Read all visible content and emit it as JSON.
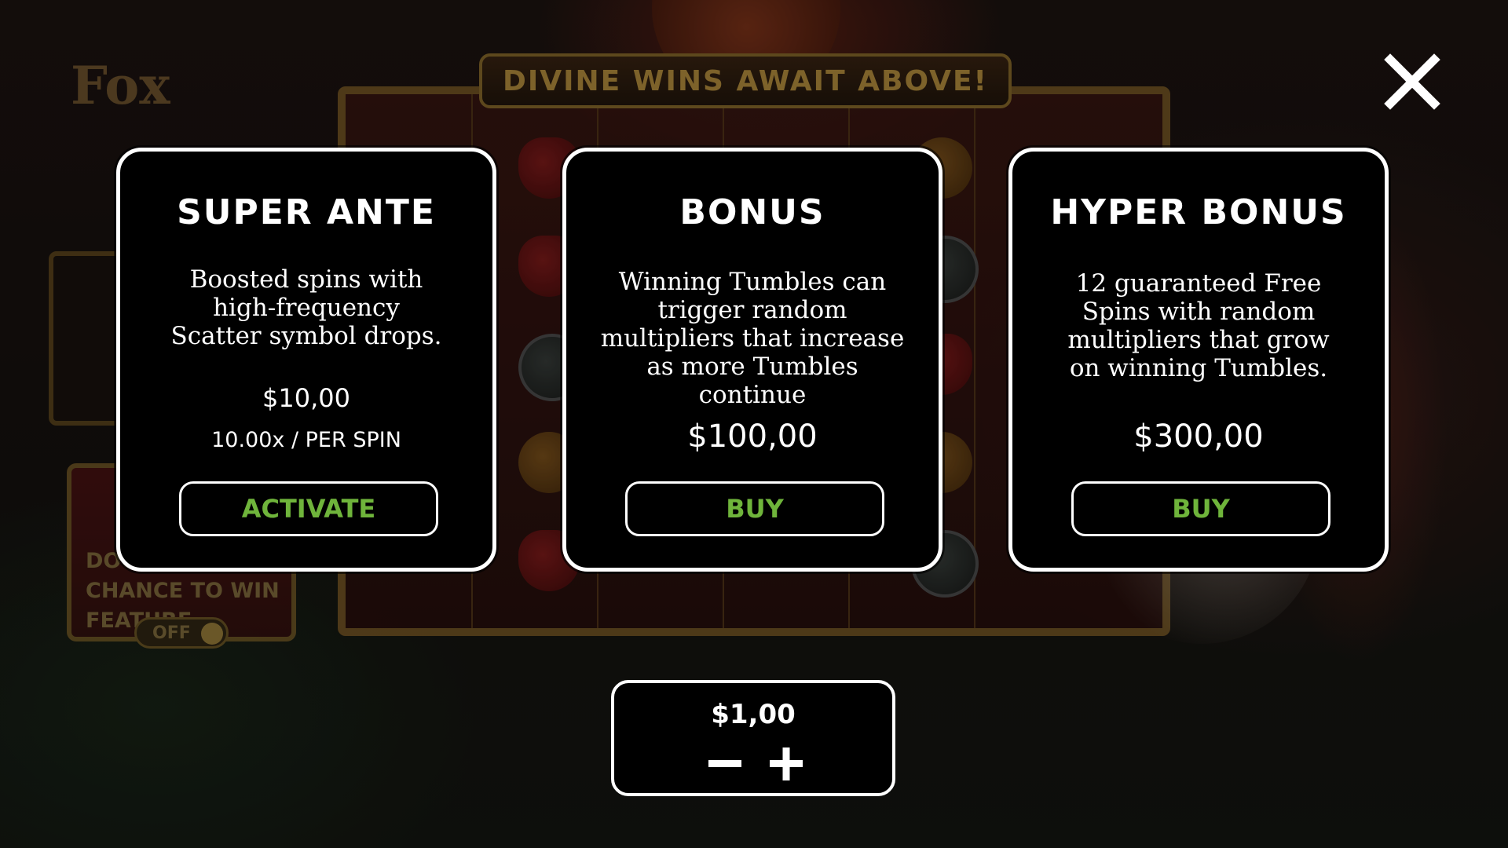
{
  "background": {
    "banner_text": "DIVINE WINS AWAIT ABOVE!",
    "logo_text": "Fox",
    "feature_panel_text": "DOUBLE CHANCE TO WIN FEATURE",
    "feature_toggle_label": "OFF"
  },
  "close_icon": "close-icon",
  "cards": [
    {
      "title": "SUPER ANTE",
      "description": "Boosted spins with high-frequency Scatter symbol drops.",
      "price": "$10,00",
      "subtext": "10.00x / PER SPIN",
      "button_label": "ACTIVATE"
    },
    {
      "title": "BONUS",
      "description": "Winning Tumbles can trigger random multipliers that increase as more Tumbles continue",
      "price": "$100,00",
      "button_label": "BUY"
    },
    {
      "title": "HYPER BONUS",
      "description": "12 guaranteed Free Spins with random multipliers that grow on winning Tumbles.",
      "price": "$300,00",
      "button_label": "BUY"
    }
  ],
  "bet": {
    "value": "$1,00",
    "minus_icon": "minus-icon",
    "plus_icon": "plus-icon"
  },
  "colors": {
    "card_background": "#000000",
    "card_border": "#ffffff",
    "button_text": "#6fb43b",
    "banner_gold": "#b8913f"
  }
}
